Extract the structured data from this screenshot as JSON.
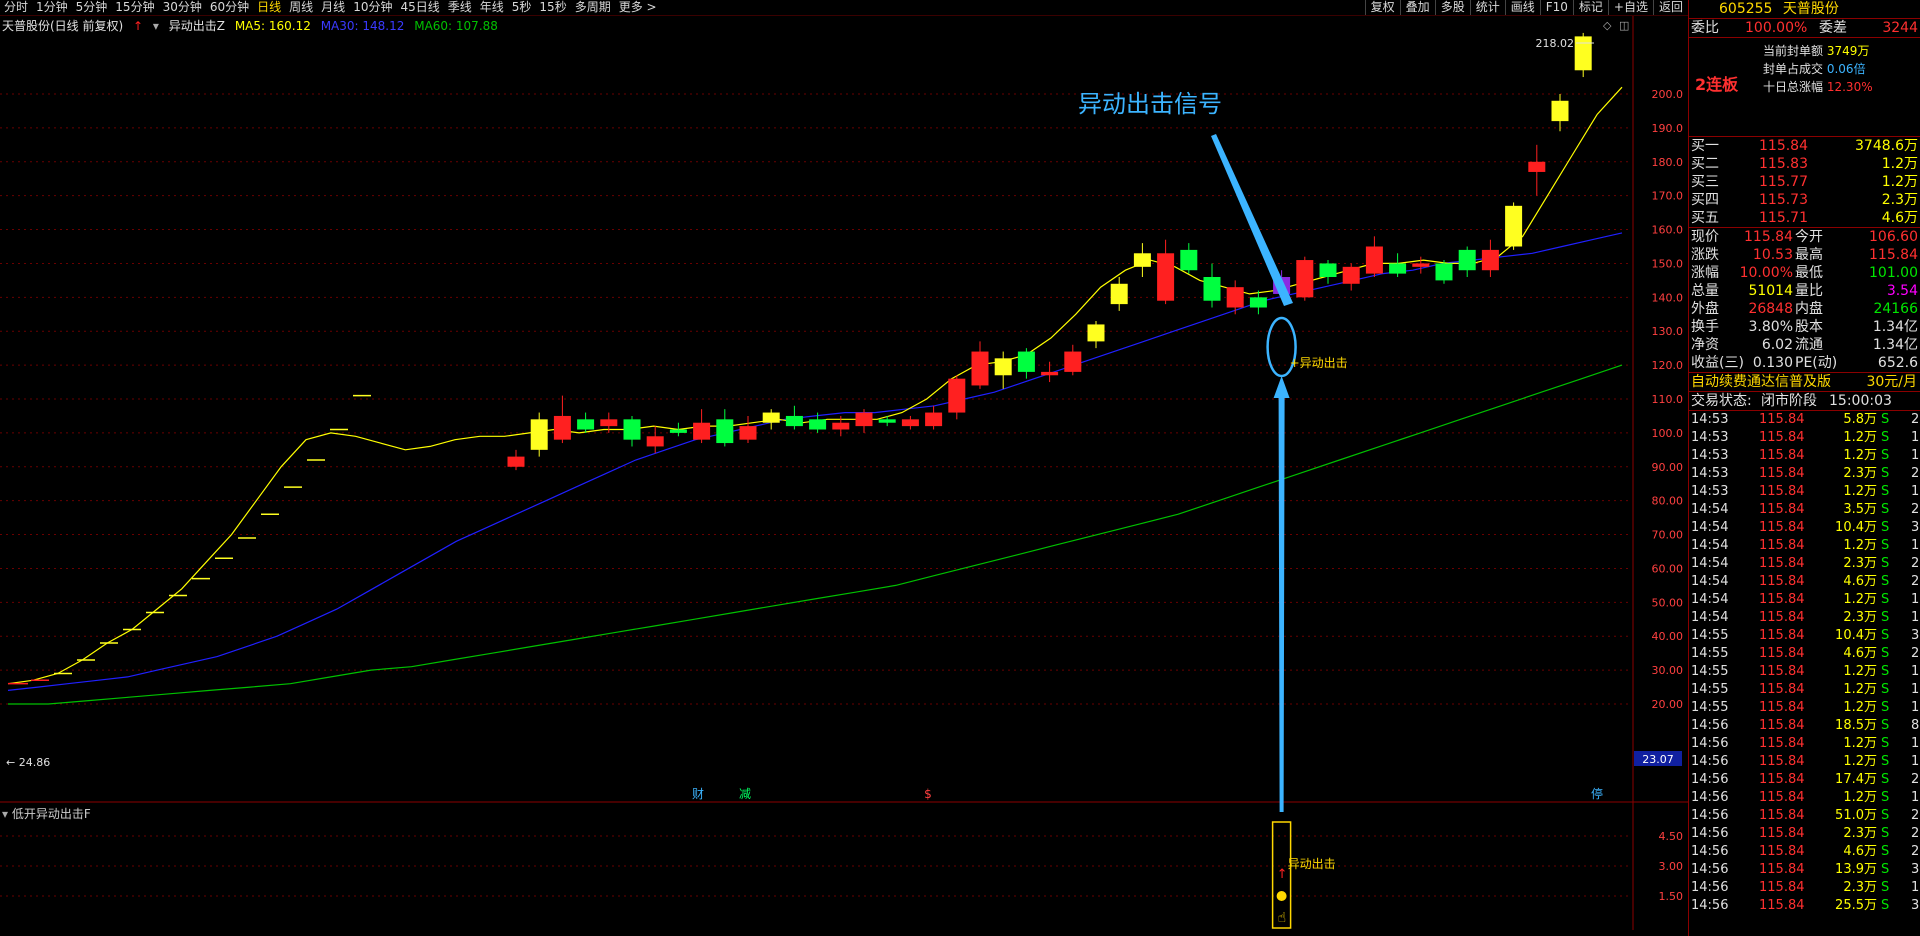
{
  "topbar": {
    "periods": [
      "分时",
      "1分钟",
      "5分钟",
      "15分钟",
      "30分钟",
      "60分钟",
      "日线",
      "周线",
      "月线",
      "10分钟",
      "45日线",
      "季线",
      "年线",
      "5秒",
      "15秒",
      "多周期",
      "更多 >"
    ],
    "active_period": "日线",
    "tools": [
      "复权",
      "叠加",
      "多股",
      "统计",
      "画线",
      "F10",
      "标记",
      "+自选",
      "返回"
    ]
  },
  "chart": {
    "stock_label": "天普股份(日线 前复权)",
    "indicator": "异动出击Z",
    "ma5": "MA5: 160.12",
    "ma30": "MA30: 148.12",
    "ma60": "MA60: 107.88",
    "ma_colors": {
      "ma5": "#ffff00",
      "ma30": "#2020ff",
      "ma60": "#00c000"
    },
    "y_ticks": [
      "200.0",
      "190.0",
      "180.0",
      "170.0",
      "160.0",
      "150.0",
      "140.0",
      "130.0",
      "120.0",
      "110.0",
      "100.0",
      "90.00",
      "80.00",
      "70.00",
      "60.00",
      "50.00",
      "40.00",
      "30.00",
      "20.00"
    ],
    "high_label": "218.02",
    "low_label": "24.86",
    "price_tag": "23.07",
    "signal_title": "异动出击信号",
    "signal_label": "+异动出击",
    "events": [
      "财",
      "减",
      "$",
      "停"
    ]
  },
  "subchart": {
    "title": "低开异动出击F",
    "y_ticks": [
      "4.50",
      "3.00",
      "1.50"
    ],
    "signal_label": "异动出击"
  },
  "right_panel": {
    "code": "605255",
    "name": "天普股份",
    "weibi_label": "委比",
    "weibi_value": "100.00%",
    "weicha_label": "委差",
    "weicha_value": "3244",
    "lianban": "2连板",
    "seal_label": "当前封单额",
    "seal_value": "3749万",
    "seal_ratio_label": "封单占成交",
    "seal_ratio_value": "0.06倍",
    "ten_day_label": "十日总涨幅",
    "ten_day_value": "12.30%",
    "bids": [
      {
        "label": "买一",
        "price": "115.84",
        "vol": "3748.6万"
      },
      {
        "label": "买二",
        "price": "115.83",
        "vol": "1.2万"
      },
      {
        "label": "买三",
        "price": "115.77",
        "vol": "1.2万"
      },
      {
        "label": "买四",
        "price": "115.73",
        "vol": "2.3万"
      },
      {
        "label": "买五",
        "price": "115.71",
        "vol": "4.6万"
      }
    ],
    "stats": [
      {
        "l1": "现价",
        "v1": "115.84",
        "c1": "red",
        "l2": "今开",
        "v2": "106.60",
        "c2": "red"
      },
      {
        "l1": "涨跌",
        "v1": "10.53",
        "c1": "red",
        "l2": "最高",
        "v2": "115.84",
        "c2": "red"
      },
      {
        "l1": "涨幅",
        "v1": "10.00%",
        "c1": "red",
        "l2": "最低",
        "v2": "101.00",
        "c2": "green"
      },
      {
        "l1": "总量",
        "v1": "51014",
        "c1": "yellow",
        "l2": "量比",
        "v2": "3.54",
        "c2": "purple"
      },
      {
        "l1": "外盘",
        "v1": "26848",
        "c1": "red",
        "l2": "内盘",
        "v2": "24166",
        "c2": "green"
      },
      {
        "l1": "换手",
        "v1": "3.80%",
        "c1": "white",
        "l2": "股本",
        "v2": "1.34亿",
        "c2": "white"
      },
      {
        "l1": "净资",
        "v1": "6.02",
        "c1": "white",
        "l2": "流通",
        "v2": "1.34亿",
        "c2": "white"
      },
      {
        "l1": "收益(三)",
        "v1": "0.130",
        "c1": "white",
        "l2": "PE(动)",
        "v2": "652.6",
        "c2": "white"
      }
    ],
    "ad_text": "自动续费通达信普及版",
    "ad_price": "30元/月",
    "trade_status_label": "交易状态:",
    "trade_status": "闭市阶段",
    "trade_time": "15:00:03",
    "ticks": [
      {
        "t": "14:53",
        "p": "115.84",
        "v": "5.8万",
        "s": "S",
        "n": "2"
      },
      {
        "t": "14:53",
        "p": "115.84",
        "v": "1.2万",
        "s": "S",
        "n": "1"
      },
      {
        "t": "14:53",
        "p": "115.84",
        "v": "1.2万",
        "s": "S",
        "n": "1"
      },
      {
        "t": "14:53",
        "p": "115.84",
        "v": "2.3万",
        "s": "S",
        "n": "2"
      },
      {
        "t": "14:53",
        "p": "115.84",
        "v": "1.2万",
        "s": "S",
        "n": "1"
      },
      {
        "t": "14:54",
        "p": "115.84",
        "v": "3.5万",
        "s": "S",
        "n": "2"
      },
      {
        "t": "14:54",
        "p": "115.84",
        "v": "10.4万",
        "s": "S",
        "n": "3"
      },
      {
        "t": "14:54",
        "p": "115.84",
        "v": "1.2万",
        "s": "S",
        "n": "1"
      },
      {
        "t": "14:54",
        "p": "115.84",
        "v": "2.3万",
        "s": "S",
        "n": "2"
      },
      {
        "t": "14:54",
        "p": "115.84",
        "v": "4.6万",
        "s": "S",
        "n": "2"
      },
      {
        "t": "14:54",
        "p": "115.84",
        "v": "1.2万",
        "s": "S",
        "n": "1"
      },
      {
        "t": "14:54",
        "p": "115.84",
        "v": "2.3万",
        "s": "S",
        "n": "1"
      },
      {
        "t": "14:55",
        "p": "115.84",
        "v": "10.4万",
        "s": "S",
        "n": "3"
      },
      {
        "t": "14:55",
        "p": "115.84",
        "v": "4.6万",
        "s": "S",
        "n": "2"
      },
      {
        "t": "14:55",
        "p": "115.84",
        "v": "1.2万",
        "s": "S",
        "n": "1"
      },
      {
        "t": "14:55",
        "p": "115.84",
        "v": "1.2万",
        "s": "S",
        "n": "1"
      },
      {
        "t": "14:55",
        "p": "115.84",
        "v": "1.2万",
        "s": "S",
        "n": "1"
      },
      {
        "t": "14:56",
        "p": "115.84",
        "v": "18.5万",
        "s": "S",
        "n": "8"
      },
      {
        "t": "14:56",
        "p": "115.84",
        "v": "1.2万",
        "s": "S",
        "n": "1"
      },
      {
        "t": "14:56",
        "p": "115.84",
        "v": "1.2万",
        "s": "S",
        "n": "1"
      },
      {
        "t": "14:56",
        "p": "115.84",
        "v": "17.4万",
        "s": "S",
        "n": "2"
      },
      {
        "t": "14:56",
        "p": "115.84",
        "v": "1.2万",
        "s": "S",
        "n": "1"
      },
      {
        "t": "14:56",
        "p": "115.84",
        "v": "51.0万",
        "s": "S",
        "n": "2"
      },
      {
        "t": "14:56",
        "p": "115.84",
        "v": "2.3万",
        "s": "S",
        "n": "2"
      },
      {
        "t": "14:56",
        "p": "115.84",
        "v": "4.6万",
        "s": "S",
        "n": "2"
      },
      {
        "t": "14:56",
        "p": "115.84",
        "v": "13.9万",
        "s": "S",
        "n": "3"
      },
      {
        "t": "14:56",
        "p": "115.84",
        "v": "2.3万",
        "s": "S",
        "n": "1"
      },
      {
        "t": "14:56",
        "p": "115.84",
        "v": "25.5万",
        "s": "S",
        "n": "3"
      }
    ]
  },
  "chart_data": {
    "type": "candlestick",
    "candles": [
      {
        "o": 93,
        "c": 90,
        "h": 95,
        "l": 89,
        "col": "red"
      },
      {
        "o": 95,
        "c": 104,
        "h": 106,
        "l": 93,
        "col": "yellow"
      },
      {
        "o": 98,
        "c": 105,
        "h": 111,
        "l": 97,
        "col": "red"
      },
      {
        "o": 104,
        "c": 101,
        "h": 106,
        "l": 100,
        "col": "green"
      },
      {
        "o": 102,
        "c": 104,
        "h": 106,
        "l": 100,
        "col": "red"
      },
      {
        "o": 104,
        "c": 98,
        "h": 105,
        "l": 96,
        "col": "green"
      },
      {
        "o": 96,
        "c": 99,
        "h": 102,
        "l": 94,
        "col": "red"
      },
      {
        "o": 101,
        "c": 100,
        "h": 103,
        "l": 99,
        "col": "green"
      },
      {
        "o": 98,
        "c": 103,
        "h": 107,
        "l": 97,
        "col": "red"
      },
      {
        "o": 104,
        "c": 97,
        "h": 107,
        "l": 96,
        "col": "green"
      },
      {
        "o": 98,
        "c": 102,
        "h": 105,
        "l": 97,
        "col": "red"
      },
      {
        "o": 103,
        "c": 106,
        "h": 107,
        "l": 101,
        "col": "yellow"
      },
      {
        "o": 105,
        "c": 102,
        "h": 108,
        "l": 101,
        "col": "green"
      },
      {
        "o": 104,
        "c": 101,
        "h": 106,
        "l": 100,
        "col": "green"
      },
      {
        "o": 101,
        "c": 103,
        "h": 105,
        "l": 99,
        "col": "red"
      },
      {
        "o": 102,
        "c": 106,
        "h": 107,
        "l": 100,
        "col": "red"
      },
      {
        "o": 104,
        "c": 103,
        "h": 105,
        "l": 102,
        "col": "green"
      },
      {
        "o": 102,
        "c": 104,
        "h": 105,
        "l": 101,
        "col": "red"
      },
      {
        "o": 102,
        "c": 106,
        "h": 108,
        "l": 101,
        "col": "red"
      },
      {
        "o": 106,
        "c": 116,
        "h": 117,
        "l": 104,
        "col": "red"
      },
      {
        "o": 114,
        "c": 124,
        "h": 127,
        "l": 113,
        "col": "red"
      },
      {
        "o": 117,
        "c": 122,
        "h": 124,
        "l": 113,
        "col": "yellow"
      },
      {
        "o": 124,
        "c": 118,
        "h": 125,
        "l": 116,
        "col": "green"
      },
      {
        "o": 117,
        "c": 118,
        "h": 121,
        "l": 115,
        "col": "red"
      },
      {
        "o": 118,
        "c": 124,
        "h": 126,
        "l": 117,
        "col": "red"
      },
      {
        "o": 127,
        "c": 132,
        "h": 133,
        "l": 125,
        "col": "yellow"
      },
      {
        "o": 138,
        "c": 144,
        "h": 146,
        "l": 136,
        "col": "yellow"
      },
      {
        "o": 149,
        "c": 153,
        "h": 156,
        "l": 146,
        "col": "yellow"
      },
      {
        "o": 139,
        "c": 153,
        "h": 157,
        "l": 138,
        "col": "red"
      },
      {
        "o": 154,
        "c": 148,
        "h": 156,
        "l": 147,
        "col": "green"
      },
      {
        "o": 146,
        "c": 139,
        "h": 150,
        "l": 137,
        "col": "green"
      },
      {
        "o": 143,
        "c": 137,
        "h": 145,
        "l": 135,
        "col": "red"
      },
      {
        "o": 140,
        "c": 137,
        "h": 142,
        "l": 135,
        "col": "green"
      },
      {
        "o": 141,
        "c": 146,
        "h": 148,
        "l": 140,
        "col": "purple"
      },
      {
        "o": 140,
        "c": 151,
        "h": 152,
        "l": 139,
        "col": "red"
      },
      {
        "o": 150,
        "c": 146,
        "h": 151,
        "l": 144,
        "col": "green"
      },
      {
        "o": 149,
        "c": 144,
        "h": 150,
        "l": 142,
        "col": "red"
      },
      {
        "o": 147,
        "c": 155,
        "h": 158,
        "l": 146,
        "col": "red"
      },
      {
        "o": 150,
        "c": 147,
        "h": 153,
        "l": 146,
        "col": "green"
      },
      {
        "o": 149,
        "c": 150,
        "h": 152,
        "l": 147,
        "col": "red"
      },
      {
        "o": 150,
        "c": 145,
        "h": 151,
        "l": 144,
        "col": "green"
      },
      {
        "o": 154,
        "c": 148,
        "h": 155,
        "l": 146,
        "col": "green"
      },
      {
        "o": 148,
        "c": 154,
        "h": 157,
        "l": 146,
        "col": "red"
      },
      {
        "o": 155,
        "c": 167,
        "h": 168,
        "l": 154,
        "col": "yellow"
      },
      {
        "o": 177,
        "c": 180,
        "h": 185,
        "l": 170,
        "col": "red"
      },
      {
        "o": 192,
        "c": 198,
        "h": 200,
        "l": 189,
        "col": "yellow"
      },
      {
        "o": 207,
        "c": 217,
        "h": 218.02,
        "l": 205,
        "col": "yellow"
      }
    ],
    "dash_marks": [
      {
        "v": 26,
        "w": 20
      },
      {
        "v": 27,
        "w": 18
      },
      {
        "v": 29,
        "w": 18
      },
      {
        "v": 33,
        "w": 18
      },
      {
        "v": 38,
        "w": 18
      },
      {
        "v": 42,
        "w": 18
      },
      {
        "v": 47,
        "w": 18
      },
      {
        "v": 52,
        "w": 18
      },
      {
        "v": 57,
        "w": 18
      },
      {
        "v": 63,
        "w": 18
      },
      {
        "v": 69,
        "w": 18
      },
      {
        "v": 76,
        "w": 18
      },
      {
        "v": 84,
        "w": 18
      },
      {
        "v": 92,
        "w": 18
      },
      {
        "v": 101,
        "w": 18
      },
      {
        "v": 111,
        "w": 18
      }
    ],
    "ma5_series": [
      26,
      27,
      29,
      33,
      38,
      42,
      48,
      54,
      62,
      70,
      80,
      90,
      98,
      100,
      99,
      97,
      95,
      96,
      98,
      99,
      99,
      100,
      101,
      100,
      101,
      101,
      102,
      101,
      102,
      102,
      103,
      104,
      103,
      104,
      104,
      104,
      106,
      110,
      116,
      120,
      121,
      123,
      128,
      135,
      143,
      148,
      151,
      149,
      145,
      143,
      141,
      142,
      144,
      146,
      148,
      150,
      150,
      151,
      150,
      150,
      152,
      158,
      170,
      182,
      194,
      202
    ],
    "ma30_series": [
      24,
      25,
      26,
      27,
      28,
      30,
      32,
      34,
      37,
      40,
      44,
      48,
      53,
      58,
      63,
      68,
      72,
      76,
      80,
      84,
      88,
      92,
      95,
      98,
      100,
      102,
      104,
      105,
      106,
      106,
      107,
      108,
      110,
      112,
      115,
      118,
      121,
      124,
      127,
      130,
      133,
      136,
      139,
      141,
      143,
      145,
      147,
      148,
      150,
      151,
      152,
      153,
      155,
      157,
      159
    ],
    "ma60_series": [
      20,
      20,
      21,
      22,
      23,
      24,
      25,
      26,
      28,
      30,
      31,
      33,
      35,
      37,
      39,
      41,
      43,
      45,
      47,
      49,
      51,
      53,
      55,
      58,
      61,
      64,
      67,
      70,
      73,
      76,
      80,
      84,
      88,
      92,
      96,
      100,
      104,
      108,
      112,
      116,
      120
    ]
  }
}
